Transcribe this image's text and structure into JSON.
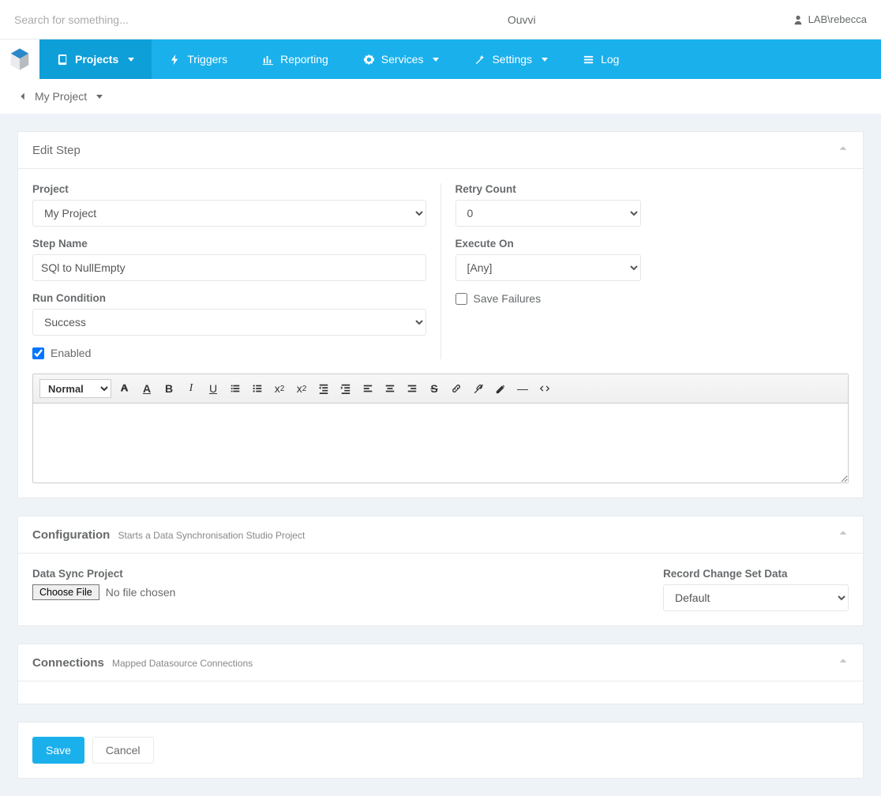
{
  "topbar": {
    "search_placeholder": "Search for something...",
    "app_title": "Ouvvi",
    "user_label": "LAB\\rebecca"
  },
  "nav": {
    "items": [
      {
        "label": "Projects",
        "hasCaret": true,
        "active": true
      },
      {
        "label": "Triggers",
        "hasCaret": false,
        "active": false
      },
      {
        "label": "Reporting",
        "hasCaret": false,
        "active": false
      },
      {
        "label": "Services",
        "hasCaret": true,
        "active": false
      },
      {
        "label": "Settings",
        "hasCaret": true,
        "active": false
      },
      {
        "label": "Log",
        "hasCaret": false,
        "active": false
      }
    ]
  },
  "breadcrumb": {
    "project_label": "My Project"
  },
  "edit_step_panel": {
    "title": "Edit Step",
    "labels": {
      "project": "Project",
      "step_name": "Step Name",
      "run_condition": "Run Condition",
      "enabled": "Enabled",
      "retry_count": "Retry Count",
      "execute_on": "Execute On",
      "save_failures": "Save Failures"
    },
    "values": {
      "project": "My Project",
      "step_name": "SQl to NullEmpty",
      "run_condition": "Success",
      "enabled": true,
      "retry_count": "0",
      "execute_on": "[Any]",
      "save_failures": false
    },
    "editor": {
      "format_label": "Normal"
    }
  },
  "configuration_panel": {
    "title": "Configuration",
    "subtitle": "Starts a Data Synchronisation Studio Project",
    "labels": {
      "data_sync_project": "Data Sync Project",
      "choose_file": "Choose File",
      "no_file": "No file chosen",
      "record_change_set": "Record Change Set Data"
    },
    "values": {
      "record_change_set": "Default"
    }
  },
  "connections_panel": {
    "title": "Connections",
    "subtitle": "Mapped Datasource Connections"
  },
  "buttons": {
    "save": "Save",
    "cancel": "Cancel"
  }
}
